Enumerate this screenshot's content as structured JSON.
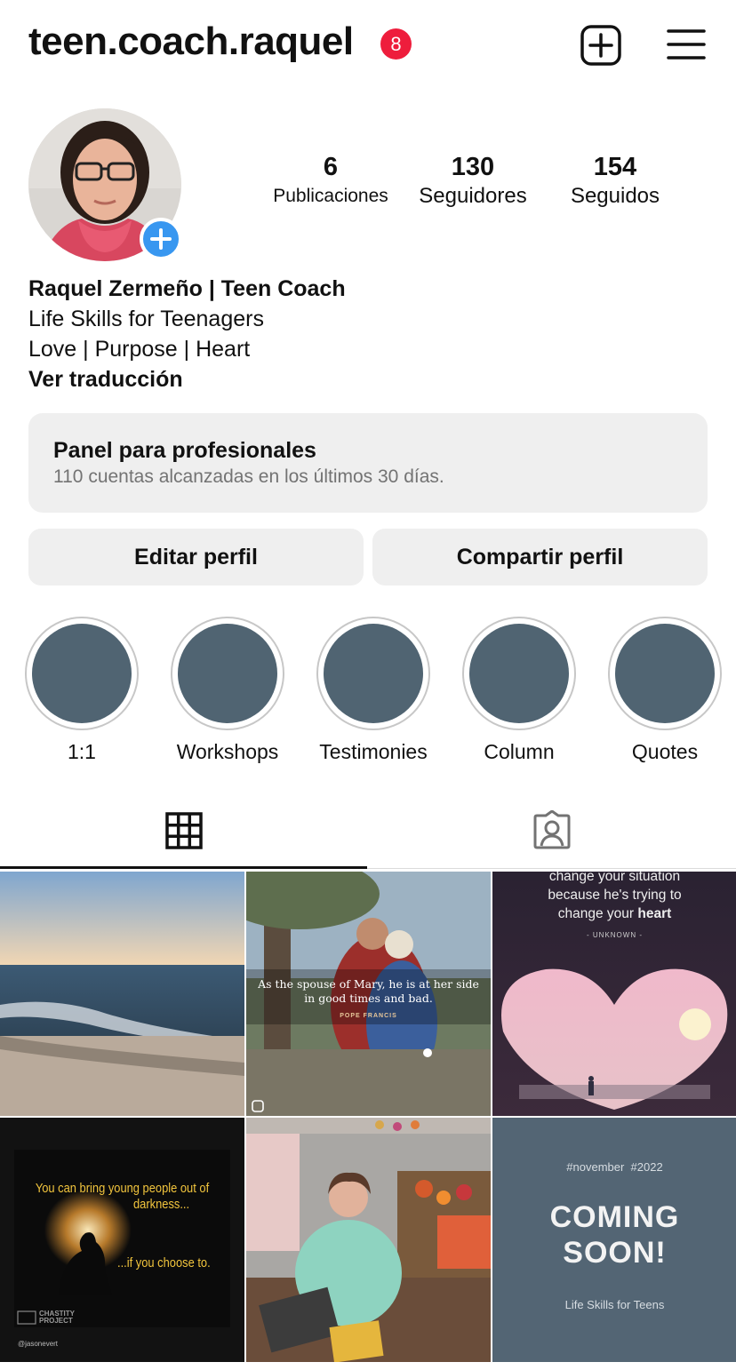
{
  "header": {
    "username": "teen.coach.raquel",
    "notification_count": "8",
    "new_post_icon": "plus-square-icon",
    "menu_icon": "hamburger-menu-icon"
  },
  "profile": {
    "stats": {
      "posts_count": "6",
      "posts_label": "Publicaciones",
      "followers_count": "130",
      "followers_label": "Seguidores",
      "following_count": "154",
      "following_label": "Seguidos"
    },
    "bio": {
      "name": "Raquel Zermeño | Teen Coach",
      "line1": "Life Skills for Teenagers",
      "line2": "Love | Purpose | Heart",
      "translate_link": "Ver traducción"
    }
  },
  "pro_panel": {
    "title": "Panel para profesionales",
    "subtitle": "110 cuentas alcanzadas en los últimos 30 días."
  },
  "actions": {
    "edit_label": "Editar perfil",
    "share_label": "Compartir perfil"
  },
  "highlights": [
    {
      "label": "1:1"
    },
    {
      "label": "Workshops"
    },
    {
      "label": "Testimonies"
    },
    {
      "label": "Column"
    },
    {
      "label": "Quotes"
    }
  ],
  "tabs": {
    "grid_icon": "grid-icon",
    "tagged_icon": "tagged-person-icon"
  },
  "posts": {
    "post2": {
      "quote": "As the spouse of Mary, he is at her side",
      "quote2": "in good times and bad.",
      "author": "POPE FRANCIS"
    },
    "post3": {
      "line1": "change your situation",
      "line2": "because he's trying to",
      "line3a": "change your ",
      "line3b": "heart",
      "author": "- UNKNOWN -"
    },
    "post4": {
      "line1": "You can bring young people out of",
      "line2": "darkness...",
      "line3": "...if you choose to.",
      "brand1": "CHASTITY",
      "brand2": "PROJECT",
      "handle": "@jasonevert"
    },
    "post6": {
      "tags": "#november  #2022",
      "headline1": "COMING",
      "headline2": "SOON!",
      "footer": "Life Skills for Teens"
    }
  },
  "colors": {
    "accent_blue": "#3897f0",
    "badge_red": "#ee1d3c",
    "highlight_fill": "#506472",
    "panel_bg": "#efefef"
  }
}
